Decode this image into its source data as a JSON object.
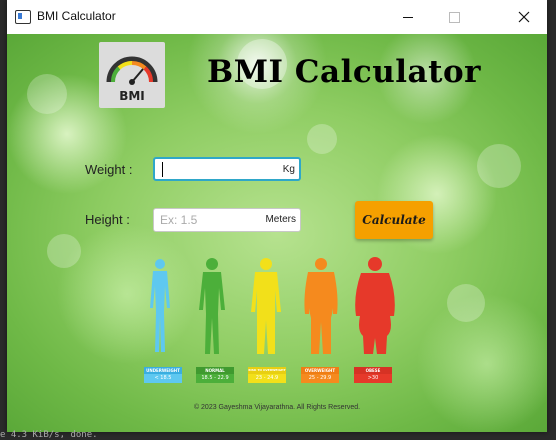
{
  "window": {
    "title": "BMI Calculator"
  },
  "app": {
    "title": "BMI Calculator",
    "logo_text": "BMI"
  },
  "form": {
    "weight_label": "Weight :",
    "weight_value": "",
    "weight_unit": "Kg",
    "height_label": "Height :",
    "height_value": "",
    "height_placeholder": "Ex: 1.5",
    "height_unit": "Meters",
    "calculate_label": "Calculate"
  },
  "categories": [
    {
      "title": "UNDERWEIGHT",
      "range": "< 18.5",
      "color": "#5ec8f0",
      "badge_color": "#3aaee0"
    },
    {
      "title": "NORMAL",
      "range": "18.5 - 22.9",
      "color": "#4caf3a",
      "badge_color": "#3f9a2f"
    },
    {
      "title": "RISK TO OVERWEIGHT",
      "range": "23 - 24.9",
      "color": "#f2e01a",
      "badge_color": "#e8cf12"
    },
    {
      "title": "OVERWEIGHT",
      "range": "25 - 29.9",
      "color": "#f58a1e",
      "badge_color": "#ef7d14"
    },
    {
      "title": "OBESE",
      "range": ">30",
      "color": "#e6392a",
      "badge_color": "#d63224"
    }
  ],
  "footer": {
    "copyright": "© 2023 Gayeshma Vijayarathna. All Rights Reserved."
  },
  "background": {
    "bottom_text": "e 4.3 KiB/s, done."
  }
}
